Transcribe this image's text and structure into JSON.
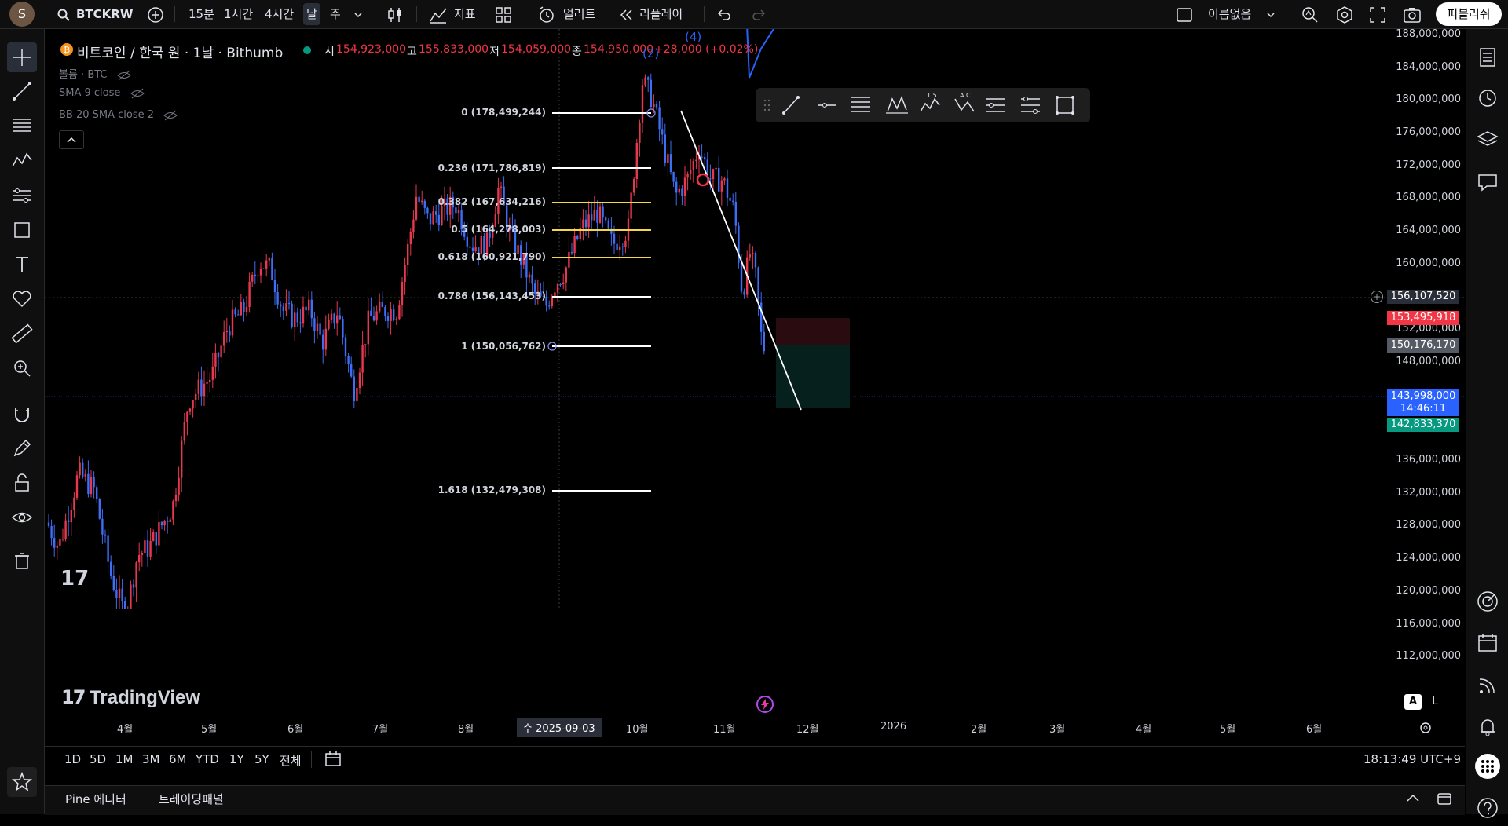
{
  "toolbar": {
    "avatar": "S",
    "symbol": "BTCKRW",
    "intervals": [
      "15분",
      "1시간",
      "4시간",
      "날",
      "주"
    ],
    "selected_interval": "날",
    "indicators_label": "지표",
    "alert_label": "얼러트",
    "replay_label": "리플레이",
    "layout_name": "이름없음",
    "publish_label": "퍼블리쉬"
  },
  "legend": {
    "title": "비트코인 / 한국 원 · 1날 · Bithumb",
    "open_label": "시",
    "open": "154,923,000",
    "high_label": "고",
    "high": "155,833,000",
    "low_label": "저",
    "low": "154,059,000",
    "close_label": "종",
    "close": "154,950,000",
    "change": "+28,000 (+0.02%)",
    "indicators": [
      "볼륨 · BTC",
      "SMA 9 close",
      "BB 20 SMA close 2"
    ]
  },
  "fib_levels": [
    {
      "label": "0 (178,499,244)",
      "color": "#ffffff"
    },
    {
      "label": "0.236 (171,786,819)",
      "color": "#ffffff"
    },
    {
      "label": "0.382 (167,634,216)",
      "color": "#f5d742"
    },
    {
      "label": "0.5 (164,278,003)",
      "color": "#f5d742"
    },
    {
      "label": "0.618 (160,921,790)",
      "color": "#f5d742"
    },
    {
      "label": "0.786 (156,143,453)",
      "color": "#ffffff"
    },
    {
      "label": "1 (150,056,762)",
      "color": "#ffffff"
    },
    {
      "label": "1.618 (132,479,308)",
      "color": "#ffffff"
    }
  ],
  "price_axis": [
    "188,000,000",
    "184,000,000",
    "180,000,000",
    "176,000,000",
    "172,000,000",
    "168,000,000",
    "164,000,000",
    "160,000,000",
    "152,000,000",
    "148,000,000",
    "136,000,000",
    "132,000,000",
    "128,000,000",
    "124,000,000",
    "120,000,000",
    "116,000,000",
    "112,000,000"
  ],
  "price_tags": {
    "crosshair": "156,107,520",
    "stop": "153,495,918",
    "entry": "150,176,170",
    "last": "143,998,000",
    "countdown": "14:46:11",
    "target": "142,833,370"
  },
  "time_axis": [
    "4월",
    "5월",
    "6월",
    "7월",
    "8월",
    "10월",
    "11월",
    "12월",
    "2026",
    "2월",
    "3월",
    "4월",
    "5월",
    "6월"
  ],
  "time_cursor": "수 2025-09-03",
  "wave_labels": [
    "(2)",
    "(4)"
  ],
  "brand": "TradingView",
  "ranges": [
    "1D",
    "5D",
    "1M",
    "3M",
    "6M",
    "YTD",
    "1Y",
    "5Y",
    "전체"
  ],
  "clock": "18:13:49 UTC+9",
  "axis_mode": [
    "A",
    "L"
  ],
  "panels": [
    "Pine 에디터",
    "트레이딩패널"
  ],
  "colors": {
    "up": "#e8384f",
    "down": "#3d6ef5",
    "stop": "#f23645",
    "last": "#2962ff",
    "target": "#089981"
  }
}
